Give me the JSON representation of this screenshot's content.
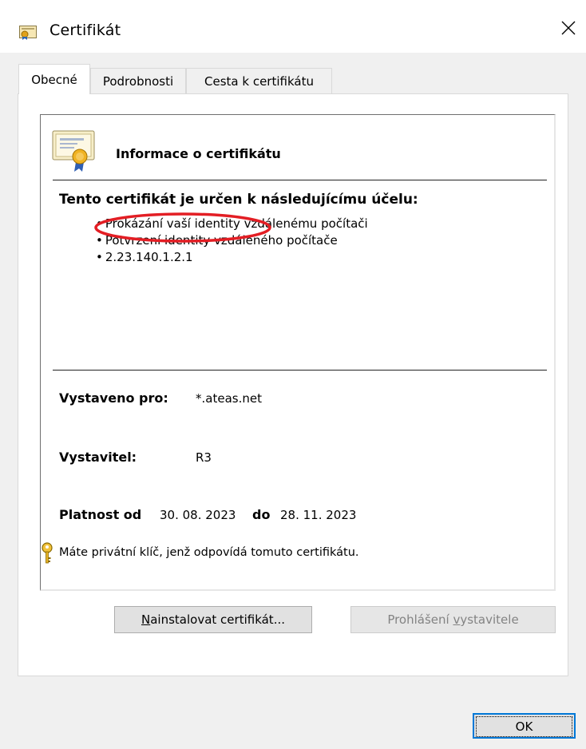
{
  "window": {
    "title": "Certifikát",
    "close_glyph": "✕"
  },
  "tabs": [
    {
      "label": "Obecné",
      "active": true
    },
    {
      "label": "Podrobnosti",
      "active": false
    },
    {
      "label": "Cesta k certifikátu",
      "active": false
    }
  ],
  "general": {
    "info_heading": "Informace o certifikátu",
    "purpose_heading": "Tento certifikát je určen k následujícímu účelu:",
    "purposes": [
      "Prokázání vaší identity vzdálenému počítači",
      "Potvrzení identity vzdáleného počítače",
      "2.23.140.1.2.1"
    ],
    "issued_to_label": "Vystaveno pro:",
    "issued_to_value": "*.ateas.net",
    "issuer_label": "Vystavitel:",
    "issuer_value": "R3",
    "valid_from_label": "Platnost od",
    "valid_from_value": "30. 08. 2023",
    "valid_to_label": "do",
    "valid_to_value": "28. 11. 2023",
    "private_key_note": "Máte privátní klíč, jenž odpovídá tomuto certifikátu."
  },
  "buttons": {
    "install": {
      "mnemonic": "N",
      "rest": "ainstalovat certifikát..."
    },
    "issuer_statement": {
      "prefix": "Prohlášení ",
      "mnemonic": "v",
      "rest": "ystavitele"
    },
    "ok": "OK"
  },
  "icons": {
    "app": "certificate-icon",
    "close": "close-icon",
    "info": "certificate-ribbon-icon",
    "key": "key-icon"
  },
  "colors": {
    "annotation": "#e31e24",
    "focus_border": "#0078d7",
    "disabled_text": "#838383"
  }
}
